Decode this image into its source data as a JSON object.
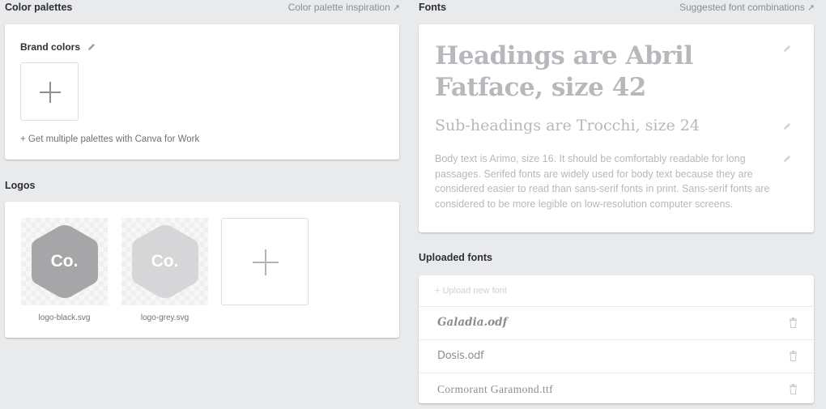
{
  "color_palettes": {
    "title": "Color palettes",
    "inspiration_link": "Color palette inspiration",
    "brand_colors_label": "Brand colors",
    "multi_palette_link": "+ Get multiple palettes with Canva for Work"
  },
  "logos": {
    "title": "Logos",
    "items": [
      {
        "name": "logo-black.svg",
        "mark": "Co.",
        "color": "#a6a6a8"
      },
      {
        "name": "logo-grey.svg",
        "mark": "Co.",
        "color": "#d6d6d8"
      }
    ]
  },
  "fonts": {
    "title": "Fonts",
    "suggestions_link": "Suggested font combinations",
    "heading_sample": "Headings are Abril Fatface, size 42",
    "subheading_sample": "Sub-headings are Trocchi, size 24",
    "body_sample": "Body text is Arimo, size 16. It should be comfortably readable for long passages. Serifed fonts are widely used for body text because they are considered easier to read than sans-serif fonts in print. Sans-serif fonts are considered to be more legible on low-resolution computer screens."
  },
  "uploaded_fonts": {
    "title": "Uploaded fonts",
    "upload_label": "+ Upload new font",
    "items": [
      {
        "name": "Galadia.odf"
      },
      {
        "name": "Dosis.odf"
      },
      {
        "name": "Cormorant Garamond.ttf"
      }
    ]
  },
  "colors": {
    "background": "#e9eaec",
    "card": "#ffffff",
    "muted_text": "#8a8d91",
    "sample_text": "#b6b8bc"
  }
}
